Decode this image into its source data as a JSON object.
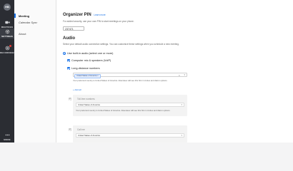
{
  "rail": {
    "avatar_initials": "HB",
    "items": [
      {
        "label": "MEETINGS",
        "icon": "video-camera-icon"
      },
      {
        "label": "SETTINGS",
        "icon": "gear-icon"
      },
      {
        "label": "RECORDINGS",
        "icon": "record-icon"
      }
    ],
    "more_label": "MORE"
  },
  "sidenav": {
    "items": [
      {
        "label": "Meeting",
        "active": true
      },
      {
        "label": "Calendar Sync",
        "active": false
      },
      {
        "label": "About",
        "active": false
      }
    ]
  },
  "organizer_pin": {
    "title": "Organizer PIN",
    "learn_more": "Learn more",
    "description": "For added security, use your own PIN to start meetings on your phone.",
    "value": "237471"
  },
  "audio": {
    "title": "Audio",
    "description": "Select your default audio connection settings. You can customize these settings when you schedule a new meeting.",
    "radio_label": "Use built-in audio (select one or more)",
    "options": [
      {
        "label": "Computer mic & speakers (VoIP)",
        "checked": true
      },
      {
        "label": "Long-distance numbers",
        "checked": true
      }
    ],
    "country_tag": "United States of America",
    "preferred_note": "Your preferred country is United States of America. Attendees will see this first in invites and dial-in options.",
    "add_all": "+ Add all",
    "toll_free": {
      "title": "Toll-free numbers",
      "value": "United States of America",
      "note": "Your preferred country is United States of America. Attendees will see this first in invites and dial-in options."
    },
    "call_me": {
      "title": "Call me",
      "value": "United States of America"
    }
  },
  "colors": {
    "rail": "#2b2d33",
    "accent": "#1a73e8"
  }
}
